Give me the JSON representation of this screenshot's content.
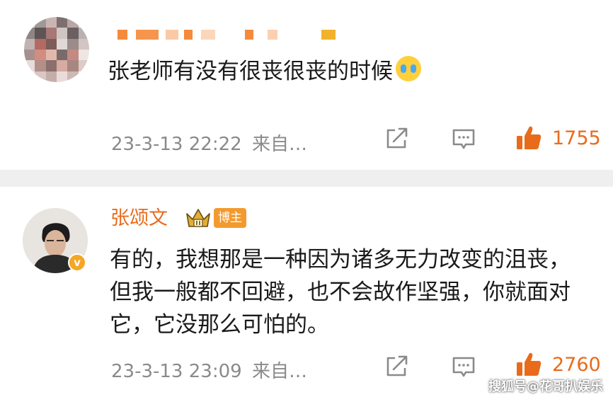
{
  "comments": [
    {
      "username": "",
      "text": "张老师有没有很丧很丧的时候",
      "emoji": "crying-face",
      "timestamp": "23-3-13 22:22",
      "source": "来自…",
      "likes": "1755"
    },
    {
      "username": "张颂文",
      "badge": "博主",
      "text": "有的，我想那是一种因为诸多无力改变的沮丧，但我一般都不回避，也不会故作坚强，你就面对它，它没那么可怕的。",
      "timestamp": "23-3-13 23:09",
      "source": "来自…",
      "likes": "2760"
    }
  ],
  "watermark": "搜狐号@花哥扒娱乐",
  "colors": {
    "accent": "#e86b1b",
    "meta_text": "#8a8a8a",
    "divider": "#efefef",
    "badge": "#f39a2e"
  },
  "icons": [
    "repost-icon",
    "comment-icon",
    "thumbs-up-icon",
    "crown-icon",
    "verified-icon"
  ]
}
